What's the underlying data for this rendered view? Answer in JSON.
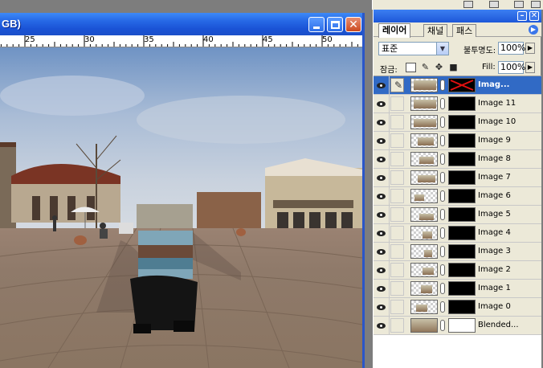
{
  "document": {
    "title_fragment": "GB)",
    "ruler_labels": [
      "25",
      "30",
      "35",
      "40",
      "45",
      "50"
    ]
  },
  "layers_panel": {
    "tabs": [
      {
        "label": "레이어",
        "active": true
      },
      {
        "label": "채널",
        "active": false
      },
      {
        "label": "패스",
        "active": false
      }
    ],
    "blend_mode": "표준",
    "opacity_label": "불투명도:",
    "opacity_value": "100%",
    "lock_label": "잠금:",
    "fill_label": "Fill:",
    "fill_value": "100%",
    "layers": [
      {
        "name": "Imag...",
        "active": true,
        "mask": "red-x"
      },
      {
        "name": "Image 11",
        "active": false,
        "mask": "black"
      },
      {
        "name": "Image 10",
        "active": false,
        "mask": "black"
      },
      {
        "name": "Image 9",
        "active": false,
        "mask": "black"
      },
      {
        "name": "Image 8",
        "active": false,
        "mask": "black"
      },
      {
        "name": "Image 7",
        "active": false,
        "mask": "black"
      },
      {
        "name": "Image 6",
        "active": false,
        "mask": "black"
      },
      {
        "name": "Image 5",
        "active": false,
        "mask": "black"
      },
      {
        "name": "Image 4",
        "active": false,
        "mask": "black"
      },
      {
        "name": "Image 3",
        "active": false,
        "mask": "black"
      },
      {
        "name": "Image 2",
        "active": false,
        "mask": "black"
      },
      {
        "name": "Image 1",
        "active": false,
        "mask": "black"
      },
      {
        "name": "Image 0",
        "active": false,
        "mask": "black"
      },
      {
        "name": "Blended...",
        "active": false,
        "mask": "white"
      }
    ]
  },
  "colors": {
    "titlebar_blue": "#1b4fc9",
    "panel_bg": "#ece9d8",
    "selection_blue": "#316ac5"
  }
}
